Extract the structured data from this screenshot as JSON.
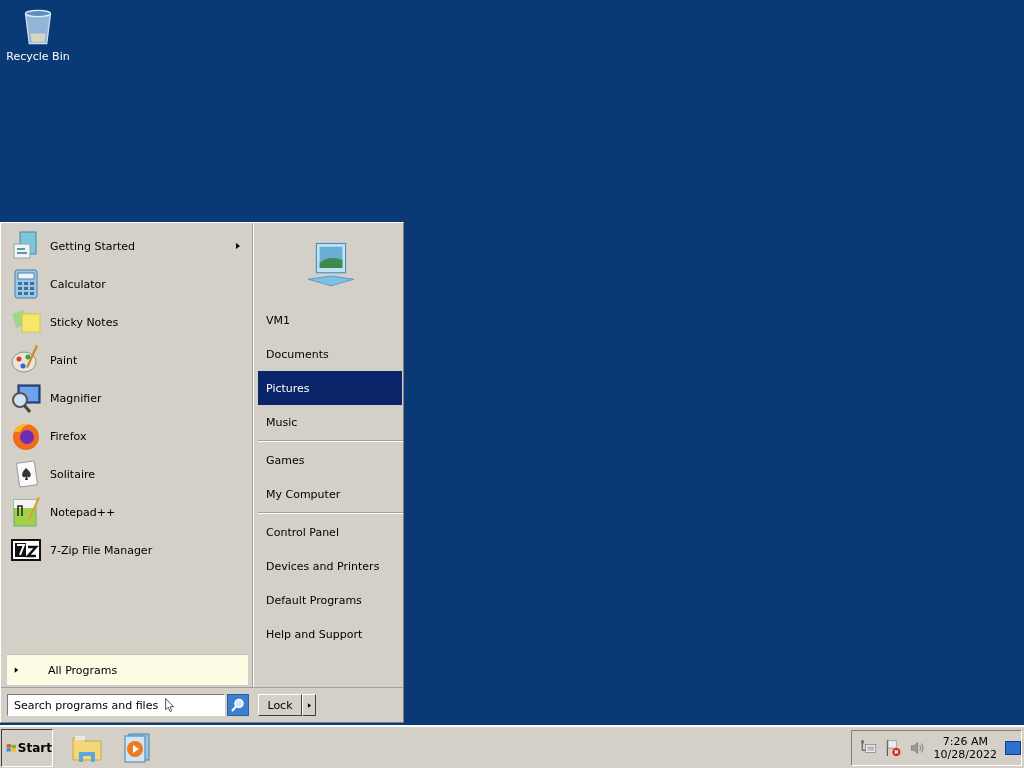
{
  "desktop": {
    "icons": [
      {
        "label": "Recycle Bin",
        "kind": "recycle"
      }
    ]
  },
  "start_menu": {
    "programs": [
      {
        "label": "Getting Started",
        "kind": "started",
        "submenu": true
      },
      {
        "label": "Calculator",
        "kind": "calc",
        "submenu": false
      },
      {
        "label": "Sticky Notes",
        "kind": "sticky",
        "submenu": false
      },
      {
        "label": "Paint",
        "kind": "paint",
        "submenu": false
      },
      {
        "label": "Magnifier",
        "kind": "magnifier",
        "submenu": false
      },
      {
        "label": "Firefox",
        "kind": "firefox",
        "submenu": false
      },
      {
        "label": "Solitaire",
        "kind": "solitaire",
        "submenu": false
      },
      {
        "label": "Notepad++",
        "kind": "notepad",
        "submenu": false
      },
      {
        "label": "7-Zip File Manager",
        "kind": "zip",
        "submenu": false
      }
    ],
    "all_programs": {
      "label": "All Programs"
    },
    "search": {
      "placeholder": "Search programs and files"
    },
    "place_groups": [
      {
        "items": [
          {
            "label": "VM1",
            "selected": false
          },
          {
            "label": "Documents",
            "selected": false
          },
          {
            "label": "Pictures",
            "selected": true
          },
          {
            "label": "Music",
            "selected": false
          }
        ]
      },
      {
        "items": [
          {
            "label": "Games",
            "selected": false
          },
          {
            "label": "My Computer",
            "selected": false
          }
        ]
      },
      {
        "items": [
          {
            "label": "Control Panel",
            "selected": false
          },
          {
            "label": "Devices and Printers",
            "selected": false
          },
          {
            "label": "Default Programs",
            "selected": false
          },
          {
            "label": "Help and Support",
            "selected": false
          }
        ]
      }
    ],
    "shutdown": {
      "label": "Lock"
    }
  },
  "taskbar": {
    "start": {
      "label": "Start"
    },
    "pinned": [
      {
        "kind": "explorer"
      },
      {
        "kind": "media"
      }
    ],
    "tray": [
      {
        "kind": "network"
      },
      {
        "kind": "flag"
      },
      {
        "kind": "volume"
      }
    ],
    "clock": {
      "time": "7:26 AM",
      "date": "10/28/2022"
    }
  }
}
